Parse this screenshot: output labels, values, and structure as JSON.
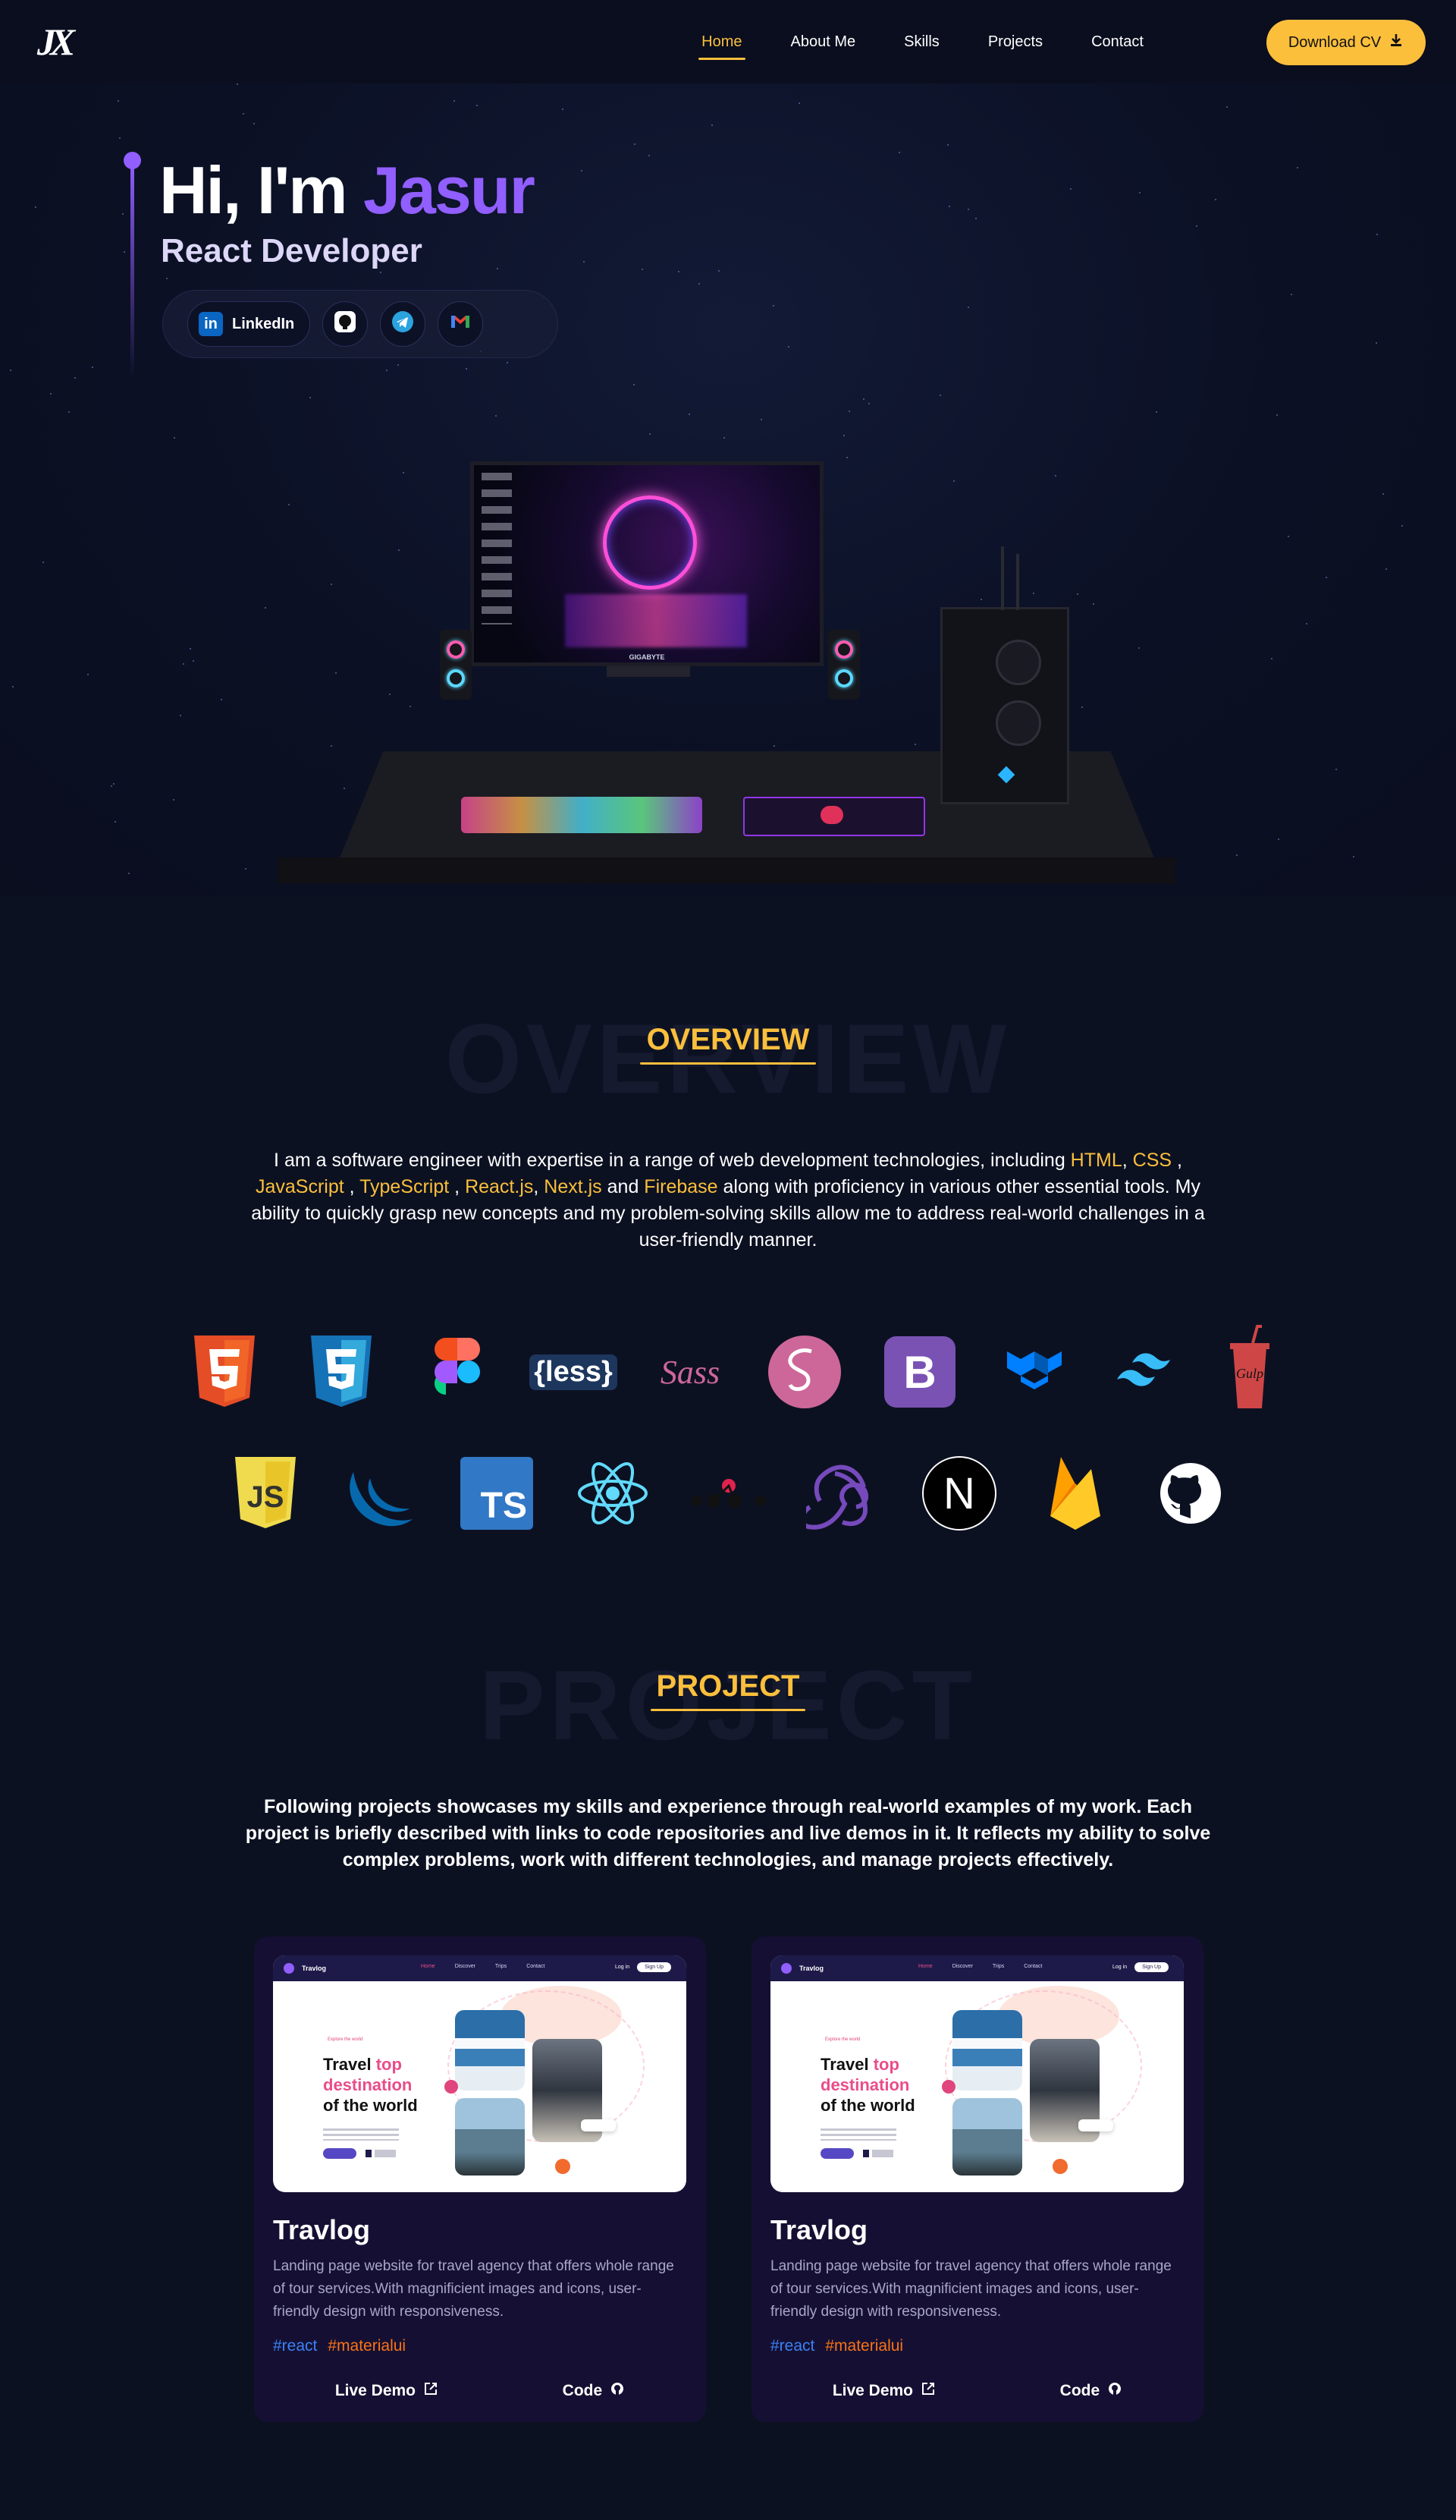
{
  "nav": {
    "logo": "JX",
    "links": [
      {
        "label": "Home",
        "active": true
      },
      {
        "label": "About Me",
        "active": false
      },
      {
        "label": "Skills",
        "active": false
      },
      {
        "label": "Projects",
        "active": false
      },
      {
        "label": "Contact",
        "active": false
      }
    ],
    "cv_label": "Download CV",
    "cv_icon": "download-icon"
  },
  "hero": {
    "greeting": "Hi, I'm",
    "name": "Jasur",
    "role": "React Developer",
    "social": {
      "linkedin_label": "LinkedIn",
      "linkedin_icon": "linkedin-icon",
      "github_icon": "github-icon",
      "telegram_icon": "telegram-icon",
      "gmail_icon": "gmail-icon"
    },
    "monitor_brand": "GIGABYTE"
  },
  "overview": {
    "ghost": "OVERVIEW",
    "heading": "OVERVIEW",
    "text_parts": {
      "p1": "I am a software engineer with expertise in a range of web development technologies, including ",
      "html": "HTML",
      "sep1": ", ",
      "css": "CSS",
      "sep2": " , ",
      "js": "JavaScript",
      "sep3": " , ",
      "ts": "TypeScript",
      "sep4": " , ",
      "react": "React.js",
      "sep5": ", ",
      "next": "Next.js",
      "sep6": " and ",
      "firebase": "Firebase",
      "p2": " along with proficiency in various other essential tools. My ability to quickly grasp new concepts and my problem-solving skills allow me to address real-world challenges in a user-friendly manner."
    }
  },
  "skills": {
    "row1": [
      "html5-icon",
      "css3-icon",
      "figma-icon",
      "less-icon",
      "sass-icon",
      "sass-circle-icon",
      "bootstrap-icon",
      "materialui-icon",
      "tailwind-icon",
      "gulp-icon"
    ],
    "row2": [
      "javascript-icon",
      "jquery-icon",
      "typescript-icon",
      "react-icon",
      "redux-saga-icon",
      "redux-icon",
      "nextjs-icon",
      "firebase-icon",
      "github-icon"
    ],
    "labels": {
      "less": "{less}",
      "sass": "Sass",
      "ts": "TS",
      "js": "JS",
      "gulp": "Gulp",
      "bootstrap": "B",
      "next": "N"
    }
  },
  "project": {
    "ghost": "PROJECT",
    "heading": "PROJECT",
    "intro": "Following projects showcases my skills and experience through real-world examples of my work. Each project is briefly described with links to code repositories and live demos in it. It reflects my ability to solve complex problems, work with different technologies, and manage projects effectively.",
    "cards": [
      {
        "title": "Travlog",
        "description": "Landing page website for travel agency that offers whole range of tour services.With magnificient images and icons, user-friendly design with responsiveness.",
        "tags": [
          "#react",
          "#materialui"
        ],
        "live_label": "Live Demo",
        "code_label": "Code",
        "shot": {
          "brand": "Travlog",
          "nav": [
            "Home",
            "Discover",
            "Trips",
            "Contact"
          ],
          "login": "Log in",
          "signup": "Sign Up",
          "tag": "Explore the world",
          "h1": "Travel",
          "h1b": "top",
          "h2": "destination",
          "h3": "of the world"
        }
      },
      {
        "title": "Travlog",
        "description": "Landing page website for travel agency that offers whole range of tour services.With magnificient images and icons, user-friendly design with responsiveness.",
        "tags": [
          "#react",
          "#materialui"
        ],
        "live_label": "Live Demo",
        "code_label": "Code",
        "shot": {
          "brand": "Travlog",
          "nav": [
            "Home",
            "Discover",
            "Trips",
            "Contact"
          ],
          "login": "Log in",
          "signup": "Sign Up",
          "tag": "Explore the world",
          "h1": "Travel",
          "h1b": "top",
          "h2": "destination",
          "h3": "of the world"
        }
      }
    ]
  },
  "colors": {
    "accent": "#fbbf3c",
    "purple": "#915eff",
    "bg": "#0c1122",
    "card": "#151033"
  }
}
